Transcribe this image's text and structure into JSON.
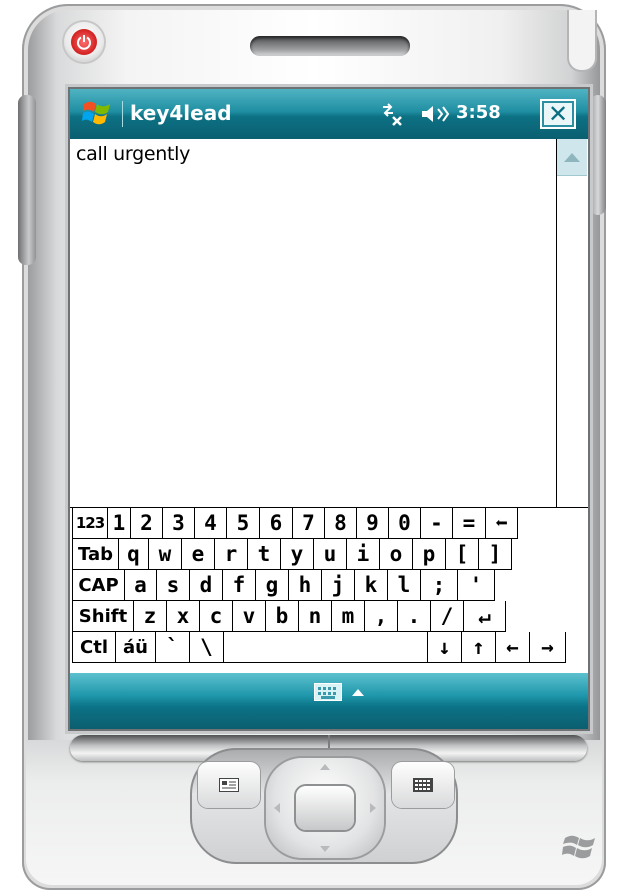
{
  "titlebar": {
    "app_title": "key4lead",
    "time": "3:58",
    "close_label": "✕",
    "icons": [
      "windows-start-icon",
      "connectivity-icon",
      "volume-icon"
    ]
  },
  "document": {
    "text": "call urgently"
  },
  "keyboard": {
    "rows": [
      [
        "123",
        "1",
        "2",
        "3",
        "4",
        "5",
        "6",
        "7",
        "8",
        "9",
        "0",
        "-",
        "=",
        "⬅"
      ],
      [
        "Tab",
        "q",
        "w",
        "e",
        "r",
        "t",
        "y",
        "u",
        "i",
        "o",
        "p",
        "[",
        "]"
      ],
      [
        "CAP",
        "a",
        "s",
        "d",
        "f",
        "g",
        "h",
        "j",
        "k",
        "l",
        ";",
        "'"
      ],
      [
        "Shift",
        "z",
        "x",
        "c",
        "v",
        "b",
        "n",
        "m",
        ",",
        ".",
        "/",
        "↵"
      ],
      [
        "Ctl",
        "áü",
        "`",
        "\\",
        "",
        "↓",
        "↑",
        "←",
        "→"
      ]
    ]
  },
  "colors": {
    "titlebar_accent": "#0d7184",
    "power_button": "#d21f1f"
  }
}
